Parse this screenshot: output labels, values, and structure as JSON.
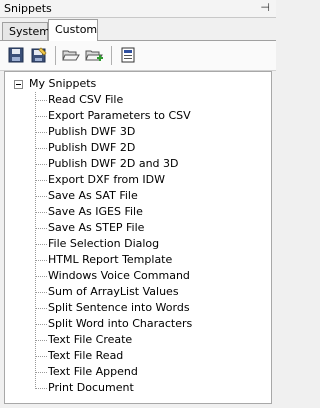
{
  "window": {
    "title": "Snippets"
  },
  "tabs": [
    {
      "label": "System"
    },
    {
      "label": "Custom"
    }
  ],
  "toolbar": {
    "buttons": [
      "save-icon",
      "save-as-icon",
      "open-folder-icon",
      "new-folder-icon",
      "snippet-window-icon"
    ]
  },
  "tree": {
    "root": "My Snippets",
    "items": [
      "Read CSV File",
      "Export Parameters to CSV",
      "Publish DWF 3D",
      "Publish DWF 2D",
      "Publish DWF 2D and 3D",
      "Export DXF from IDW",
      "Save As SAT File",
      "Save As IGES File",
      "Save As STEP File",
      "File Selection Dialog",
      "HTML Report Template",
      "Windows Voice Command",
      "Sum of ArrayList Values",
      "Split Sentence into Words",
      "Split Word into Characters",
      "Text File Create",
      "Text File Read",
      "Text File Append",
      "Print Document"
    ]
  }
}
